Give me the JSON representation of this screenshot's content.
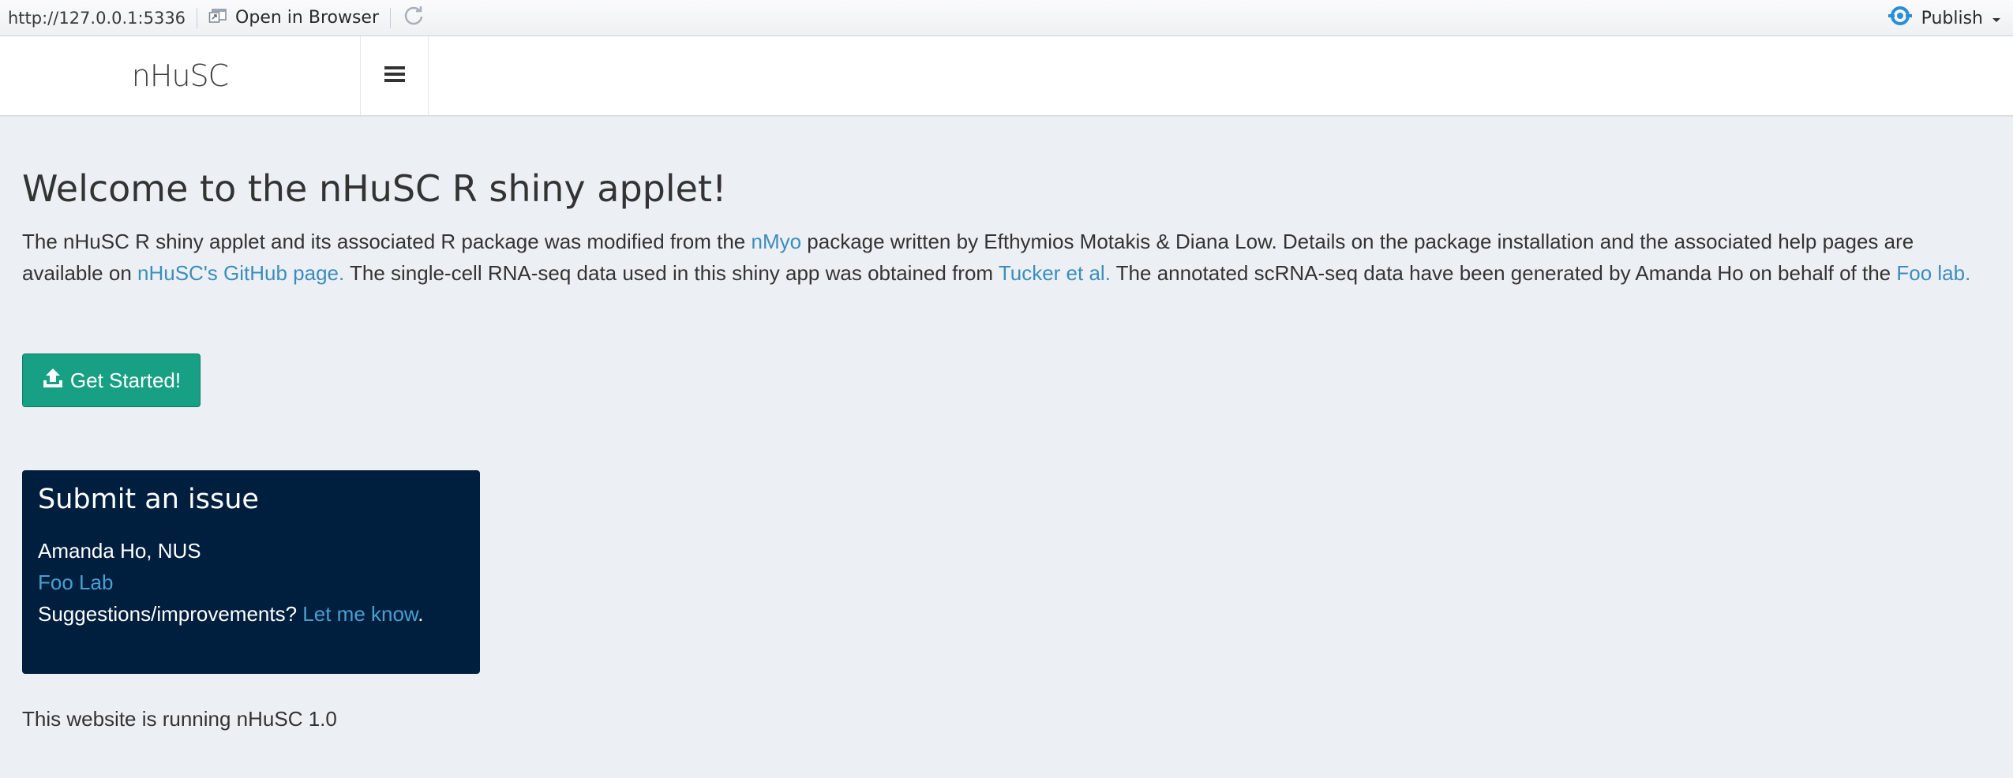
{
  "viewer": {
    "url": "http://127.0.0.1:5336",
    "open_in_browser": "Open in Browser",
    "publish": "Publish"
  },
  "header": {
    "brand": "nHuSC"
  },
  "main": {
    "title": "Welcome to the nHuSC R shiny applet!",
    "intro": {
      "t1": "The nHuSC R shiny applet and its associated R package was modified from the ",
      "link_nmyo": "nMyo",
      "t2": " package written by Efthymios Motakis & Diana Low. Details on the package installation and the associated help pages are available on ",
      "link_github": "nHuSC's GitHub page.",
      "t3": " The single-cell RNA-seq data used in this shiny app was obtained from ",
      "link_tucker": "Tucker et al.",
      "t4": " The annotated scRNA-seq data have been generated by Amanda Ho on behalf of the ",
      "link_foo": "Foo lab."
    },
    "start_button": "Get Started!",
    "issue_box": {
      "title": "Submit an issue",
      "author": "Amanda Ho, NUS",
      "lab_link": "Foo Lab",
      "suggestions": "Suggestions/improvements? ",
      "let_me_know": "Let me know",
      "period": "."
    },
    "version_text": "This website is running nHuSC 1.0"
  },
  "colors": {
    "background": "#ecf0f5",
    "link": "#3c8dbc",
    "button": "#17a083",
    "issue_box": "#001f3f"
  },
  "icons": [
    "window-icon",
    "refresh-icon",
    "publish-icon",
    "chevron-down-icon",
    "hamburger-icon",
    "upload-icon"
  ]
}
